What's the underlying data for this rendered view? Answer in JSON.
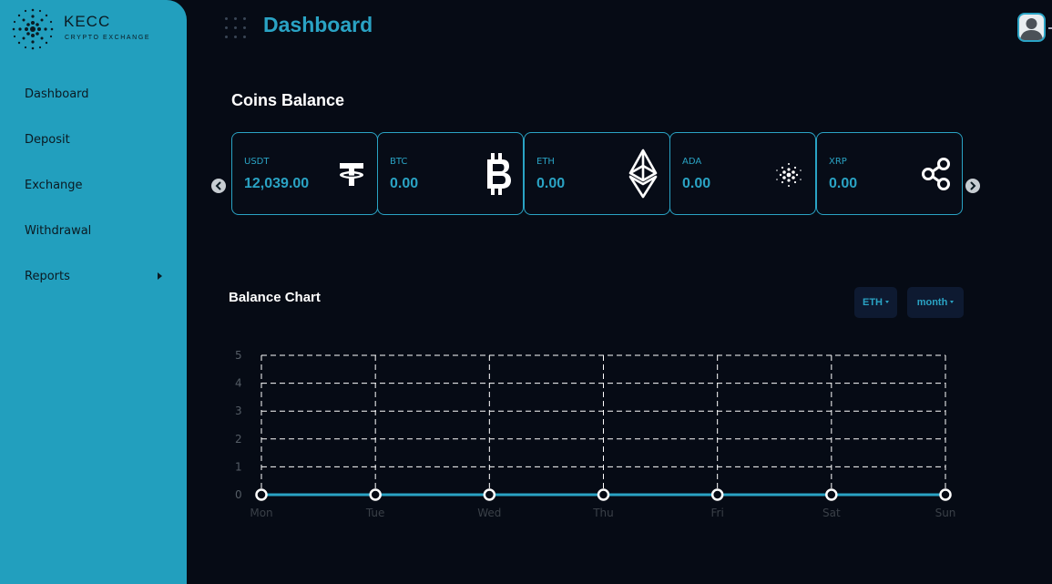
{
  "brand": {
    "name": "KECC",
    "tagline": "CRYPTO EXCHANGE"
  },
  "sidebar": {
    "items": [
      {
        "label": "Dashboard"
      },
      {
        "label": "Deposit"
      },
      {
        "label": "Exchange"
      },
      {
        "label": "Withdrawal"
      },
      {
        "label": "Reports",
        "has_submenu": true
      }
    ]
  },
  "header": {
    "title": "Dashboard"
  },
  "coins_section": {
    "title": "Coins Balance",
    "coins": [
      {
        "name": "USDT",
        "amount": "12,039.00",
        "icon": "tether-icon"
      },
      {
        "name": "BTC",
        "amount": "0.00",
        "icon": "bitcoin-icon"
      },
      {
        "name": "ETH",
        "amount": "0.00",
        "icon": "ethereum-icon"
      },
      {
        "name": "ADA",
        "amount": "0.00",
        "icon": "cardano-icon"
      },
      {
        "name": "XRP",
        "amount": "0.00",
        "icon": "xrp-icon"
      }
    ]
  },
  "balance_chart": {
    "title": "Balance Chart",
    "coin_select": "ETH",
    "period_select": "month"
  },
  "colors": {
    "sidebar": "#229fbe",
    "accent": "#2aa3c4",
    "background": "#060b15"
  },
  "chart_data": {
    "type": "line",
    "categories": [
      "Mon",
      "Tue",
      "Wed",
      "Thu",
      "Fri",
      "Sat",
      "Sun"
    ],
    "series": [
      {
        "values": [
          0,
          0,
          0,
          0,
          0,
          0,
          0
        ]
      }
    ],
    "ylim": [
      0,
      5
    ],
    "yticks": [
      0,
      1,
      2,
      3,
      4,
      5
    ],
    "grid": true,
    "line_color": "#2aa3c4"
  }
}
